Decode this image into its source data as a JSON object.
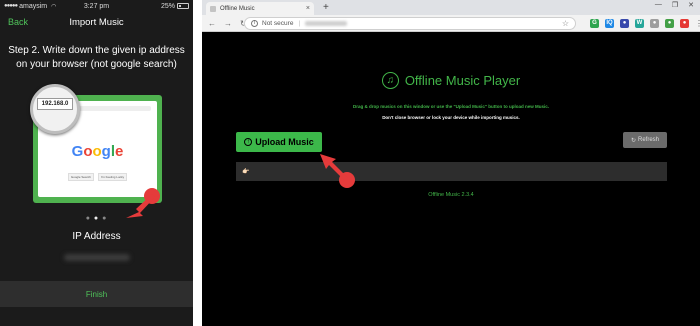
{
  "phone": {
    "status": {
      "carrier": "amaysim",
      "time": "3:27 pm",
      "battery": "25%"
    },
    "nav": {
      "back": "Back",
      "title": "Import Music"
    },
    "step_text": "Step 2. Write down the given ip address on your browser (not google search)",
    "illustration": {
      "ip_preview": "192.168.0",
      "google": [
        "G",
        "o",
        "o",
        "g",
        "l",
        "e"
      ],
      "google_colors": [
        "#4285F4",
        "#EA4335",
        "#FBBC05",
        "#4285F4",
        "#34A853",
        "#EA4335"
      ],
      "buttons": [
        "Google Search",
        "I'm Feeling Lucky"
      ]
    },
    "ip_label": "IP Address",
    "finish": "Finish"
  },
  "browser": {
    "tab_title": "Offline Music",
    "new_tab": "+",
    "security": "Not secure",
    "extensions": [
      {
        "label": "G",
        "color": "#2ea44f"
      },
      {
        "label": "IQ",
        "color": "#1e88e5"
      },
      {
        "label": "●",
        "color": "#3949ab"
      },
      {
        "label": "W",
        "color": "#26a69a"
      },
      {
        "label": "●",
        "color": "#9e9e9e"
      },
      {
        "label": "●",
        "color": "#43a047"
      },
      {
        "label": "●",
        "color": "#e53935"
      }
    ],
    "app": {
      "title": "Offline Music Player",
      "desc1": "Drag & drop musics on this window or use the \"Upload Music\" button to upload new Music.",
      "desc2": "Don't close browser or lock your device while importing musics.",
      "upload_label": "Upload Music",
      "refresh_label": "Refresh",
      "song_placeholder": "",
      "version": "Offline Music 2.3.4"
    }
  },
  "colors": {
    "accent_green": "#42b549",
    "arrow_red": "#e53b3b"
  }
}
